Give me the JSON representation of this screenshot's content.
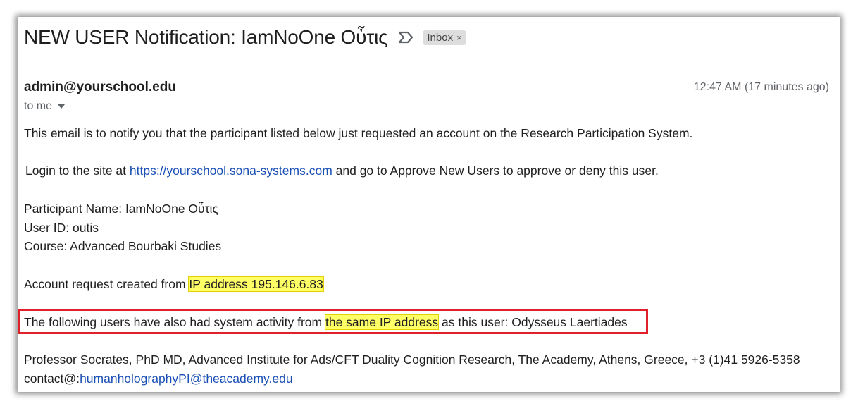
{
  "email": {
    "subject": "NEW USER Notification: IamNoOne Οὖτις",
    "label": "Inbox",
    "label_close": "×",
    "sender": "admin@yourschool.edu",
    "time": "12:47 AM (17 minutes ago)",
    "to": "to me"
  },
  "body": {
    "intro": "This email is to notify you that the participant listed below just requested an account on the Research Participation System.",
    "login_prefix": "Login to the site at ",
    "login_link": "https://yourschool.sona-systems.com",
    "login_suffix": " and go to Approve New Users to approve or deny this user.",
    "participant_name": "Participant Name: IamNoOne Οὖτις",
    "user_id": "User ID: outis",
    "course": "Course: Advanced Bourbaki Studies",
    "account_prefix": "Account request created from ",
    "account_ip": "IP address 195.146.6.83",
    "following_prefix": "The following users have also had system activity from ",
    "following_highlight": "the same IP address",
    "following_suffix": " as this user: Odysseus Laertiades",
    "signature": "Professor Socrates, PhD MD, Advanced Institute for Ads/CFT Duality Cognition Research, The Academy, Athens, Greece, +3 (1)41 5926-5358",
    "contact_prefix": "contact@:",
    "contact_link": "humanholographyPI@theacademy.edu"
  },
  "colors": {
    "highlight": "#ffff66",
    "annotation_box": "#e0202a",
    "link": "#1a4fb5"
  },
  "icons": {
    "important": "importance-marker-icon",
    "caret": "chevron-down-icon"
  }
}
